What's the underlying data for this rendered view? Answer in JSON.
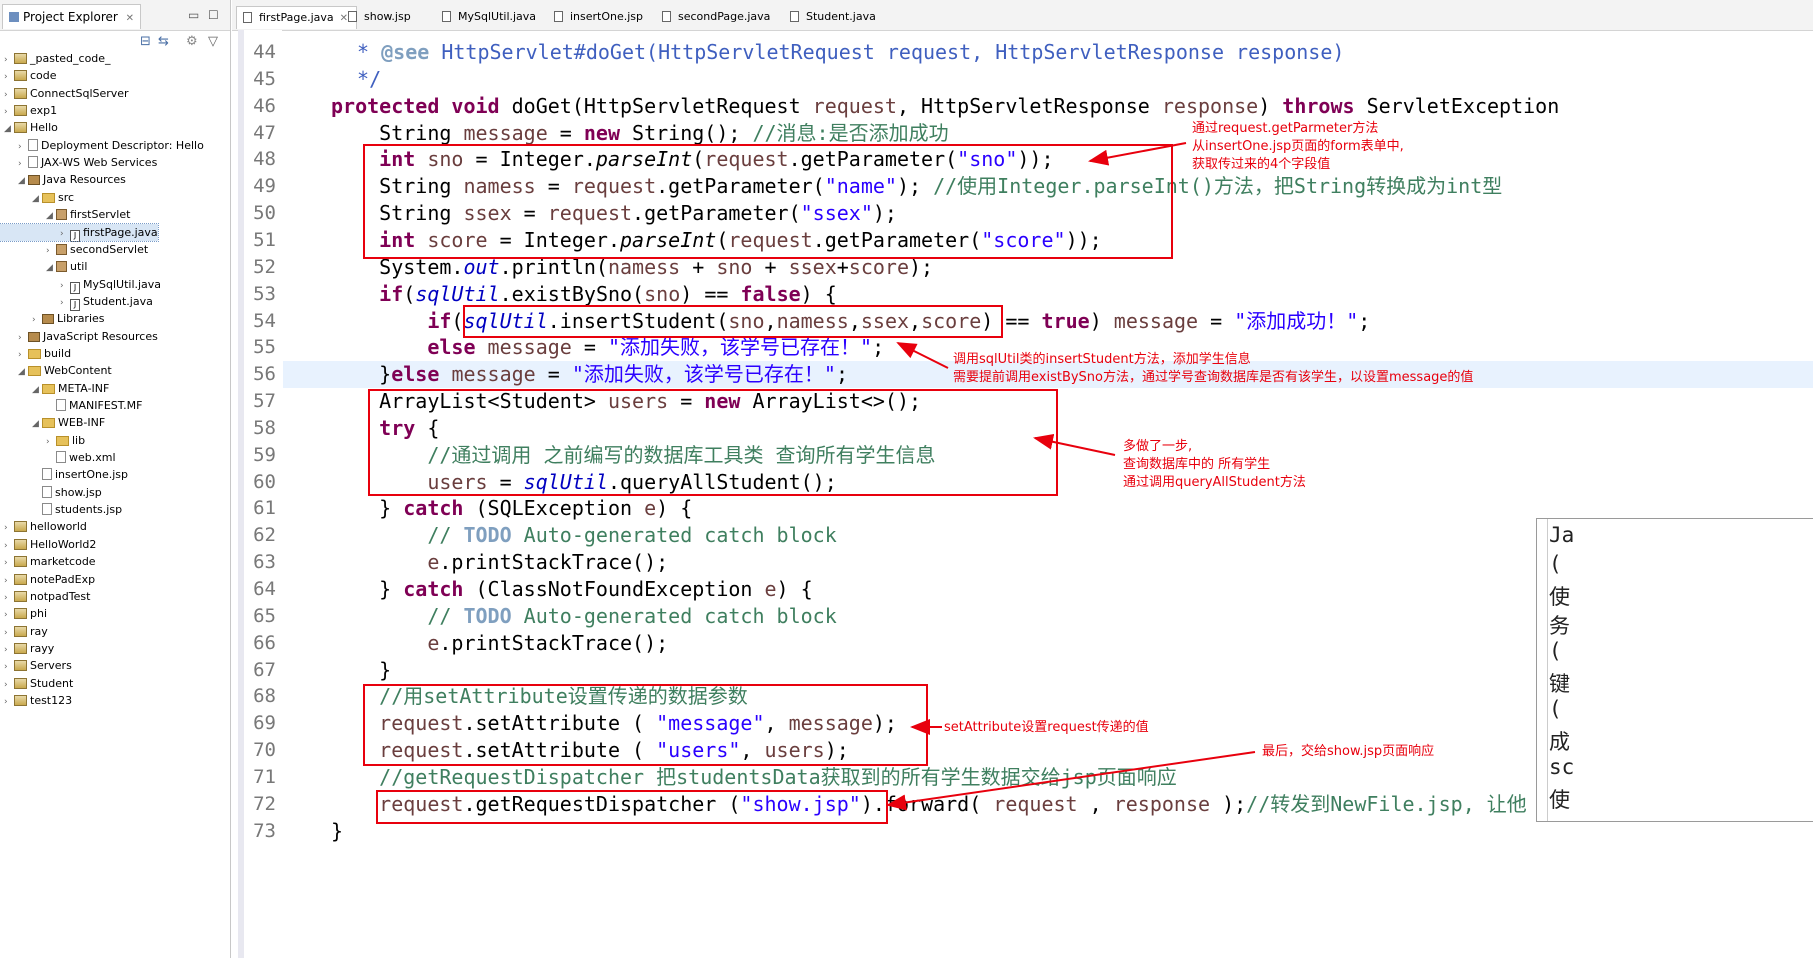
{
  "explorer": {
    "title": "Project Explorer",
    "tab_close": "✕",
    "tree": [
      {
        "label": "_pasted_code_",
        "icon": "project-icon"
      },
      {
        "label": "code",
        "icon": "project-icon"
      },
      {
        "label": "ConnectSqlServer",
        "icon": "project-icon"
      },
      {
        "label": "exp1",
        "icon": "project-icon"
      },
      {
        "label": "Hello",
        "icon": "project-icon"
      },
      {
        "label": "Deployment Descriptor: Hello",
        "icon": "descriptor-icon"
      },
      {
        "label": "JAX-WS Web Services",
        "icon": "webservice-icon"
      },
      {
        "label": "Java Resources",
        "icon": "java-resources-icon"
      },
      {
        "label": "src",
        "icon": "source-folder-icon"
      },
      {
        "label": "firstServlet",
        "icon": "package-icon"
      },
      {
        "label": "firstPage.java",
        "icon": "java-file-icon"
      },
      {
        "label": "secondServlet",
        "icon": "package-icon"
      },
      {
        "label": "util",
        "icon": "package-icon"
      },
      {
        "label": "MySqlUtil.java",
        "icon": "java-file-icon"
      },
      {
        "label": "Student.java",
        "icon": "java-file-icon"
      },
      {
        "label": "Libraries",
        "icon": "library-icon"
      },
      {
        "label": "JavaScript Resources",
        "icon": "javascript-icon"
      },
      {
        "label": "build",
        "icon": "folder-icon"
      },
      {
        "label": "WebContent",
        "icon": "folder-icon"
      },
      {
        "label": "META-INF",
        "icon": "folder-icon"
      },
      {
        "label": "MANIFEST.MF",
        "icon": "file-icon"
      },
      {
        "label": "WEB-INF",
        "icon": "folder-icon"
      },
      {
        "label": "lib",
        "icon": "folder-icon"
      },
      {
        "label": "web.xml",
        "icon": "xml-file-icon"
      },
      {
        "label": "insertOne.jsp",
        "icon": "jsp-file-icon"
      },
      {
        "label": "show.jsp",
        "icon": "jsp-file-icon"
      },
      {
        "label": "students.jsp",
        "icon": "jsp-file-icon"
      },
      {
        "label": "helloworld",
        "icon": "project-icon"
      },
      {
        "label": "HelloWorld2",
        "icon": "project-icon"
      },
      {
        "label": "marketcode",
        "icon": "project-icon"
      },
      {
        "label": "notePadExp",
        "icon": "project-icon"
      },
      {
        "label": "notpadTest",
        "icon": "project-icon"
      },
      {
        "label": "phi",
        "icon": "project-icon"
      },
      {
        "label": "ray",
        "icon": "project-icon"
      },
      {
        "label": "rayy",
        "icon": "project-icon"
      },
      {
        "label": "Servers",
        "icon": "project-icon"
      },
      {
        "label": "Student",
        "icon": "project-icon"
      },
      {
        "label": "test123",
        "icon": "project-icon"
      }
    ]
  },
  "editor_tabs": [
    {
      "label": "firstPage.java",
      "close": "✕"
    },
    {
      "label": "show.jsp"
    },
    {
      "label": "MySqlUtil.java"
    },
    {
      "label": "insertOne.jsp"
    },
    {
      "label": "secondPage.java"
    },
    {
      "label": "Student.java"
    }
  ],
  "line_numbers": [
    "44",
    "45",
    "46",
    "47",
    "48",
    "49",
    "50",
    "51",
    "52",
    "53",
    "54",
    "55",
    "56",
    "57",
    "58",
    "59",
    "60",
    "61",
    "62",
    "63",
    "64",
    "65",
    "66",
    "67",
    "68",
    "69",
    "70",
    "71",
    "72",
    "73"
  ],
  "code": {
    "l44": {
      "a": " * ",
      "b": "@see",
      "c": " HttpServlet#doGet(HttpServletRequest request, HttpServletResponse response)"
    },
    "l45": {
      "a": " */"
    },
    "l46": {
      "a": "protected void",
      "b": " doGet(HttpServletRequest ",
      "c": "request",
      ",d": "",
      "d": ", HttpServletResponse ",
      "e": "response",
      ")f": "",
      "f": ") ",
      "g": "throws",
      " h": "",
      "h": " ServletException"
    },
    "l47": {
      "a": "    String ",
      "b": "message",
      " c": "",
      "c": " = ",
      "d": "new",
      "e": " String(); ",
      "f": "//消息:是否添加成功"
    },
    "l48": {
      "a": "    ",
      "b": "int",
      "c": " ",
      "d": "sno",
      "e": " = Integer.",
      "f": "parseInt",
      "g": "(",
      "h": "request",
      ".i": "",
      "i": ".getParameter(",
      "j": "\"sno\"",
      "k": "));"
    },
    "l49": {
      "a": "    String ",
      "b": "namess",
      "c": " = ",
      "d": "request",
      "e": ".getParameter(",
      "f": "\"name\"",
      "g": "); ",
      "h": "//使用Integer.parseInt()方法，把String转换成为int型"
    },
    "l50": {
      "a": "    String ",
      "b": "ssex",
      "c": " = ",
      "d": "request",
      "e": ".getParameter(",
      "f": "\"ssex\"",
      "g": ");"
    },
    "l51": {
      "a": "    ",
      "b": "int",
      "c": " ",
      "d": "score",
      "e": " = Integer.",
      "f": "parseInt",
      "g": "(",
      "h": "request",
      "i": ".getParameter(",
      "j": "\"score\"",
      "k": "));"
    },
    "l52": {
      "a": "    System.",
      "b": "out",
      "c": ".println(",
      "d": "namess",
      "e": " + ",
      "f": "sno",
      "g": " + ",
      "h": "ssex",
      "i": "+",
      "j": "score",
      "k": ");"
    },
    "l53": {
      "a": "    ",
      "b": "if",
      "c": "(",
      "d": "sqlUtil",
      "e": ".existBySno(",
      "f": "sno",
      "g": ") == ",
      "h": "false",
      "i": ") {"
    },
    "l54": {
      "a": "        ",
      "b": "if",
      "c": "(",
      "d": "sqlUtil",
      "e": ".insertStudent(",
      "f": "sno",
      "g": ",",
      "h": "namess",
      "i": ",",
      "j": "ssex",
      "k": ",",
      "l": "score",
      "m": ") == ",
      "n": "true",
      "o": ") ",
      "p": "message",
      "q": " = ",
      "r": "\"添加成功！\"",
      "s": ";"
    },
    "l55": {
      "a": "        ",
      "b": "else",
      "c": " ",
      "d": "message",
      "e": " = ",
      "f": "\"添加失败，该学号已存在！\"",
      "g": ";"
    },
    "l56": {
      "a": "    }",
      "b": "else",
      "c": " ",
      "d": "message",
      "e": " = ",
      "f": "\"添加失败，该学号已存在！\"",
      "g": ";"
    },
    "l57": {
      "a": "    ArrayList<Student> ",
      "b": "users",
      "c": " = ",
      "d": "new",
      "e": " ArrayList<>();"
    },
    "l58": {
      "a": "    ",
      "b": "try",
      "c": " {"
    },
    "l59": {
      "a": "        ",
      "b": "//通过调用 之前编写的数据库工具类 查询所有学生信息"
    },
    "l60": {
      "a": "        ",
      "b": "users",
      "c": " = ",
      "d": "sqlUtil",
      "e": ".queryAllStudent();"
    },
    "l61": {
      "a": "    } ",
      "b": "catch",
      "c": " (SQLException ",
      "d": "e",
      "e": ") {"
    },
    "l62": {
      "a": "        ",
      "b": "// ",
      "c": "TODO",
      "d": " Auto-generated catch block"
    },
    "l63": {
      "a": "        ",
      "b": "e",
      "c": ".printStackTrace();"
    },
    "l64": {
      "a": "    } ",
      "b": "catch",
      "c": " (ClassNotFoundException ",
      "d": "e",
      "e": ") {"
    },
    "l65": {
      "a": "        ",
      "b": "// ",
      "c": "TODO",
      "d": " Auto-generated catch block"
    },
    "l66": {
      "a": "        ",
      "b": "e",
      "c": ".printStackTrace();"
    },
    "l67": {
      "a": "    }"
    },
    "l68": {
      "a": "    ",
      "b": "//用setAttribute设置传递的数据参数"
    },
    "l69": {
      "a": "    ",
      "b": "request",
      "c": ".setAttribute ( ",
      "d": "\"message\"",
      "e": ", ",
      "f": "message",
      "g": ");"
    },
    "l70": {
      "a": "    ",
      "b": "request",
      "c": ".setAttribute ( ",
      "d": "\"users\"",
      "e": ", ",
      "f": "users",
      "g": ");"
    },
    "l71": {
      "a": "    ",
      "b": "//getRequestDispatcher 把studentsData获取到的所有学生数据交给jsp页面响应"
    },
    "l72": {
      "a": "    ",
      "b": "request",
      "c": ".getRequestDispatcher (",
      "d": "\"show.jsp\"",
      "e": ").forward( ",
      "f": "request",
      "g": " , ",
      "h": "response",
      "i": " );",
      "j": "//转发到NewFile.jsp, 让他"
    },
    "l73": {
      "a": "}"
    }
  },
  "annotations": {
    "note1": [
      "通过request.getParmeter方法",
      "从insertOne.jsp页面的form表单中,",
      "获取传过来的4个字段值"
    ],
    "note2": [
      "调用sqlUtil类的insertStudent方法，添加学生信息",
      "需要提前调用existBySno方法，通过学号查询数据库是否有该学生，以设置message的值"
    ],
    "note3": [
      "多做了一步,",
      "查询数据库中的 所有学生",
      "通过调用queryAllStudent方法"
    ],
    "note4": "setAttribute设置request传递的值",
    "note5": "最后，交给show.jsp页面响应"
  },
  "popup": [
    "Ja",
    "(",
    "使",
    "务",
    "(",
    "键",
    "(",
    "成",
    "sc",
    "使"
  ],
  "colors": {
    "keyword": "#7f0055",
    "string": "#2a00ff",
    "comment": "#3f7f5f",
    "annotation": "#e8000d"
  }
}
